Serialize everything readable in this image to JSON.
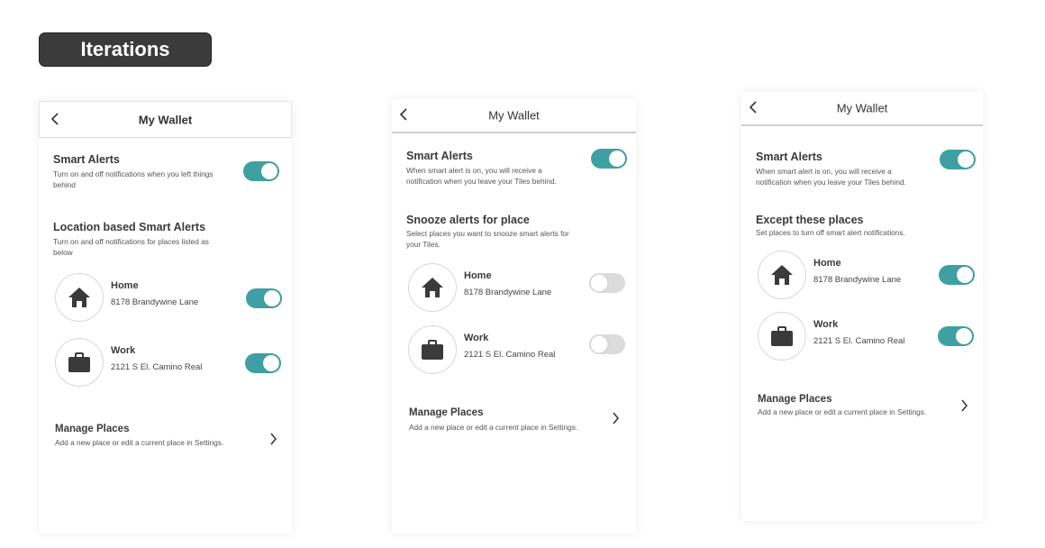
{
  "badge": {
    "label": "Iterations"
  },
  "colors": {
    "toggle_on": "#3fa0a3",
    "toggle_off": "#dcdcdc",
    "badge_bg": "#3b3b3b"
  },
  "screens": [
    {
      "header": {
        "title": "My Wallet",
        "back_icon": "chevron-left-icon"
      },
      "smart_alerts": {
        "title": "Smart Alerts",
        "description": "Turn on and off notifications when you left things behind",
        "enabled": true
      },
      "places_section": {
        "title": "Location based Smart Alerts",
        "description": "Turn on and off notifications for places listed as below"
      },
      "places": [
        {
          "name": "Home",
          "address": "8178 Brandywine Lane",
          "icon": "home-icon",
          "enabled": true
        },
        {
          "name": "Work",
          "address": "2121 S El. Camino Real",
          "icon": "briefcase-icon",
          "enabled": true
        }
      ],
      "manage": {
        "title": "Manage Places",
        "description": "Add a new place or edit a current place in Settings.",
        "icon": "chevron-right-icon"
      }
    },
    {
      "header": {
        "title": "My Wallet",
        "back_icon": "chevron-left-icon"
      },
      "smart_alerts": {
        "title": "Smart Alerts",
        "description": "When smart alert is on, you will receive a notification when you leave your Tiles behind.",
        "enabled": true
      },
      "places_section": {
        "title": "Snooze alerts for place",
        "description": "Select places you want to snooze smart alerts for your Tiles."
      },
      "places": [
        {
          "name": "Home",
          "address": "8178 Brandywine Lane",
          "icon": "home-icon",
          "enabled": false
        },
        {
          "name": "Work",
          "address": "2121 S El. Camino Real",
          "icon": "briefcase-icon",
          "enabled": false
        }
      ],
      "manage": {
        "title": "Manage Places",
        "description": "Add a new place or edit a current place in Settings.",
        "icon": "chevron-right-icon"
      }
    },
    {
      "header": {
        "title": "My Wallet",
        "back_icon": "chevron-left-icon"
      },
      "smart_alerts": {
        "title": "Smart Alerts",
        "description": "When smart alert is on, you will receive a notification when you leave your Tiles behind.",
        "enabled": true
      },
      "places_section": {
        "title": "Except these places",
        "description": "Set places to turn off smart alert notifications."
      },
      "places": [
        {
          "name": "Home",
          "address": "8178 Brandywine Lane",
          "icon": "home-icon",
          "enabled": true
        },
        {
          "name": "Work",
          "address": "2121 S El. Camino Real",
          "icon": "briefcase-icon",
          "enabled": true
        }
      ],
      "manage": {
        "title": "Manage Places",
        "description": "Add a new place or edit a current place in Settings.",
        "icon": "chevron-right-icon"
      }
    }
  ]
}
